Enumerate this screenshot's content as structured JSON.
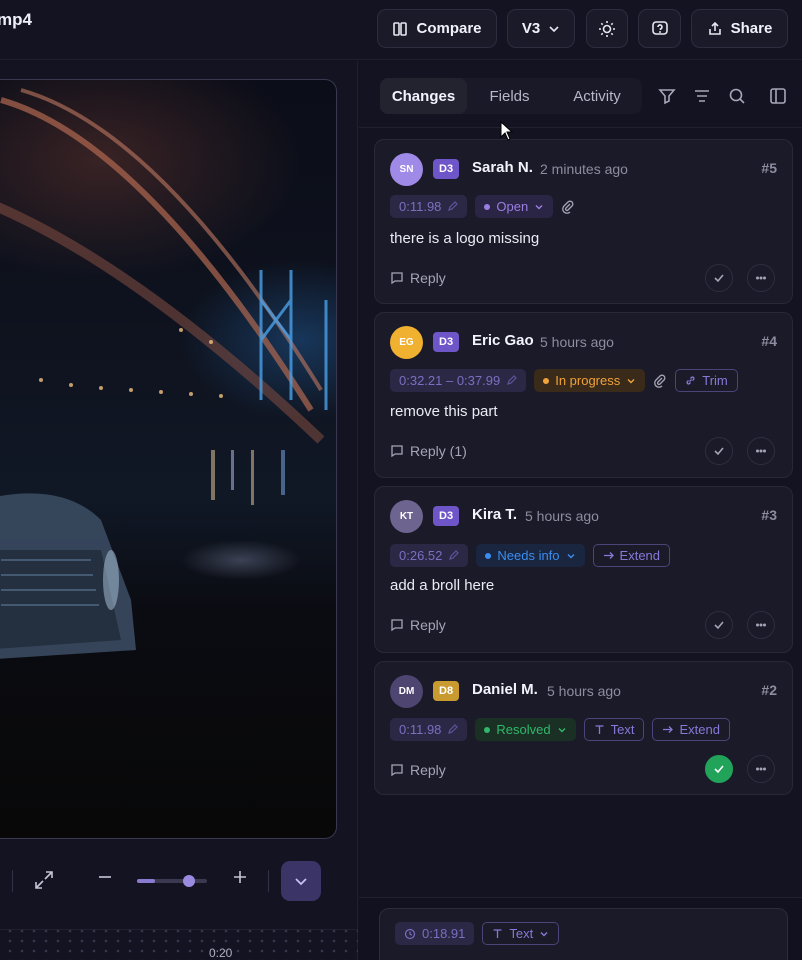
{
  "header": {
    "file_title": "mp4",
    "compare_label": "Compare",
    "version_label": "V3",
    "share_label": "Share"
  },
  "player": {
    "timeline_label": "0:20",
    "zoom_level": 0.25
  },
  "panel": {
    "tabs": [
      {
        "label": "Changes",
        "active": true
      },
      {
        "label": "Fields",
        "active": false
      },
      {
        "label": "Activity",
        "active": false
      }
    ]
  },
  "comments": [
    {
      "initials": "SN",
      "avatar_color": "#a08ae8",
      "device": "D3",
      "device_color": "#6e55c8",
      "author": "Sarah N.",
      "time": "2 minutes ago",
      "number": "#5",
      "timestamp": "0:11.98",
      "status": "Open",
      "status_color": "#9a7ee0",
      "status_bg": "#2a2545",
      "attachment": true,
      "tags": [],
      "text": "there is a logo missing",
      "reply": "Reply",
      "resolved": false
    },
    {
      "initials": "EG",
      "avatar_color": "#f0b030",
      "device": "D3",
      "device_color": "#6e55c8",
      "author": "Eric Gao",
      "time": "5 hours ago",
      "number": "#4",
      "timestamp": "0:32.21 – 0:37.99",
      "status": "In progress",
      "status_color": "#f2a23a",
      "status_bg": "#3a2a1a",
      "attachment": true,
      "tags": [
        {
          "icon": "link",
          "label": "Trim"
        }
      ],
      "text": "remove this part",
      "reply": "Reply (1)",
      "resolved": false
    },
    {
      "initials": "KT",
      "avatar_color": "#6e6490",
      "device": "D3",
      "device_color": "#6e55c8",
      "author": "Kira T.",
      "time": "5 hours ago",
      "number": "#3",
      "timestamp": "0:26.52",
      "status": "Needs info",
      "status_color": "#3a8ef0",
      "status_bg": "#1a2540",
      "attachment": false,
      "tags": [
        {
          "icon": "arrow",
          "label": "Extend"
        }
      ],
      "text": "add a broll here",
      "reply": "Reply",
      "resolved": false
    },
    {
      "initials": "DM",
      "avatar_color": "#4e4670",
      "device": "D8",
      "device_color": "#c89a30",
      "author": "Daniel M.",
      "time": "5 hours ago",
      "number": "#2",
      "timestamp": "0:11.98",
      "status": "Resolved",
      "status_color": "#2fb86a",
      "status_bg": "#1a3025",
      "attachment": false,
      "tags": [
        {
          "icon": "text",
          "label": "Text"
        },
        {
          "icon": "arrow",
          "label": "Extend"
        }
      ],
      "text": "",
      "reply": "Reply",
      "resolved": true
    }
  ],
  "composer": {
    "timestamp": "0:18.91",
    "type_label": "Text"
  }
}
